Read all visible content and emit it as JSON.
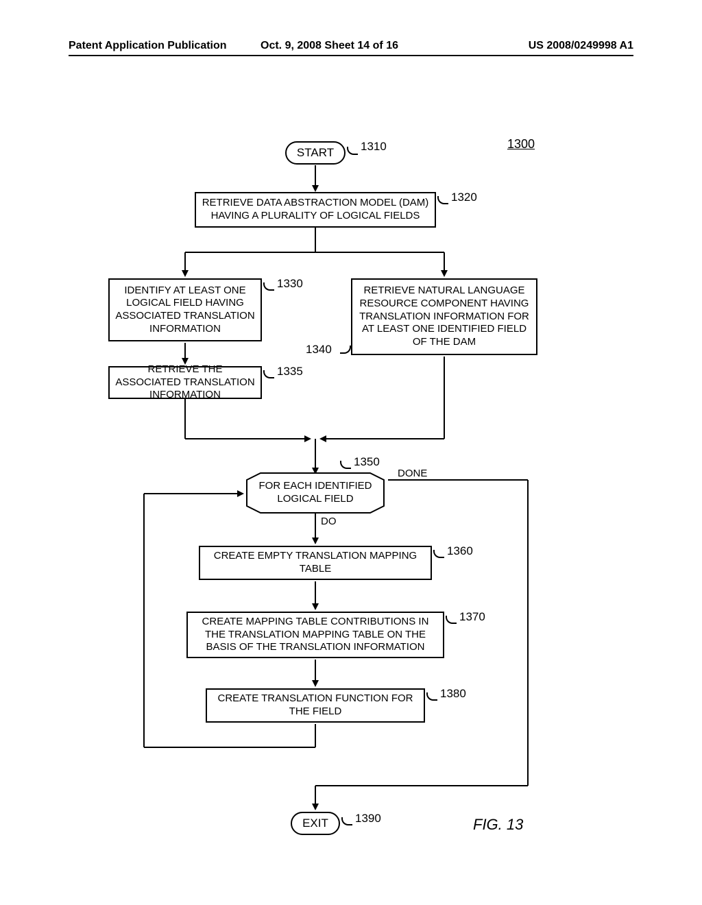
{
  "header": {
    "left": "Patent Application Publication",
    "mid": "Oct. 9, 2008   Sheet 14 of 16",
    "right": "US 2008/0249998 A1"
  },
  "figure_number": "1300",
  "figure_label": "FIG. 13",
  "nodes": {
    "start": "START",
    "n1320": "RETRIEVE DATA ABSTRACTION MODEL (DAM) HAVING A PLURALITY OF LOGICAL FIELDS",
    "n1330": "IDENTIFY AT LEAST ONE LOGICAL FIELD HAVING ASSOCIATED TRANSLATION INFORMATION",
    "n1335": "RETRIEVE THE ASSOCIATED TRANSLATION INFORMATION",
    "n1340": "RETRIEVE NATURAL LANGUAGE RESOURCE COMPONENT HAVING TRANSLATION INFORMATION FOR AT LEAST ONE IDENTIFIED FIELD OF THE DAM",
    "n1350": "FOR EACH IDENTIFIED LOGICAL FIELD",
    "n1360": "CREATE EMPTY TRANSLATION MAPPING TABLE",
    "n1370": "CREATE MAPPING TABLE CONTRIBUTIONS IN THE TRANSLATION MAPPING TABLE ON THE BASIS OF THE TRANSLATION INFORMATION",
    "n1380": "CREATE TRANSLATION FUNCTION FOR THE FIELD",
    "exit": "EXIT"
  },
  "edge_labels": {
    "done": "DONE",
    "do": "DO"
  },
  "refs": {
    "r1310": "1310",
    "r1320": "1320",
    "r1330": "1330",
    "r1335": "1335",
    "r1340": "1340",
    "r1350": "1350",
    "r1360": "1360",
    "r1370": "1370",
    "r1380": "1380",
    "r1390": "1390"
  }
}
